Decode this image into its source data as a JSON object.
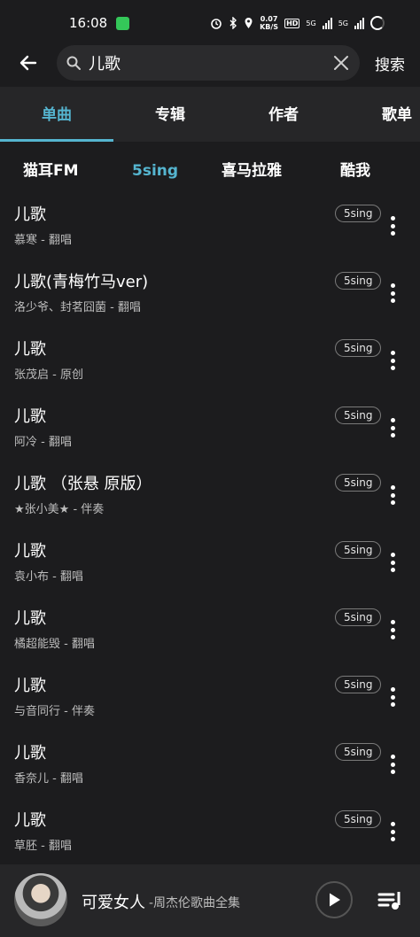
{
  "status": {
    "time": "16:08",
    "speed_value": "0.07",
    "speed_unit": "KB/S",
    "hd_badge": "HD",
    "net1": "5G",
    "net2": "5G"
  },
  "search": {
    "query": "儿歌",
    "button": "搜索"
  },
  "tabs": [
    {
      "label": "单曲",
      "active": true
    },
    {
      "label": "专辑",
      "active": false
    },
    {
      "label": "作者",
      "active": false
    },
    {
      "label": "歌单",
      "active": false
    }
  ],
  "sources": [
    {
      "label": "猫耳FM",
      "active": false
    },
    {
      "label": "5sing",
      "active": true
    },
    {
      "label": "喜马拉雅",
      "active": false
    },
    {
      "label": "酷我",
      "active": false
    }
  ],
  "results": [
    {
      "title": "儿歌",
      "sub": "慕寒 - 翻唱",
      "tag": "5sing"
    },
    {
      "title": "儿歌(青梅竹马ver)",
      "sub": "洛少爷、封茗囧菌 - 翻唱",
      "tag": "5sing"
    },
    {
      "title": "儿歌",
      "sub": "张茂启 - 原创",
      "tag": "5sing"
    },
    {
      "title": "儿歌",
      "sub": "阿冷 - 翻唱",
      "tag": "5sing"
    },
    {
      "title": "儿歌 （张悬 原版）",
      "sub": "★张小美★ - 伴奏",
      "tag": "5sing"
    },
    {
      "title": "儿歌",
      "sub": "袁小布 - 翻唱",
      "tag": "5sing"
    },
    {
      "title": "儿歌",
      "sub": "橘超能毁 - 翻唱",
      "tag": "5sing"
    },
    {
      "title": "儿歌",
      "sub": "与音同行 - 伴奏",
      "tag": "5sing"
    },
    {
      "title": "儿歌",
      "sub": "香奈儿 - 翻唱",
      "tag": "5sing"
    },
    {
      "title": "儿歌",
      "sub": "草胚 - 翻唱",
      "tag": "5sing"
    }
  ],
  "now_playing": {
    "title": "可爱女人",
    "subtitle": "-周杰伦歌曲全集"
  }
}
